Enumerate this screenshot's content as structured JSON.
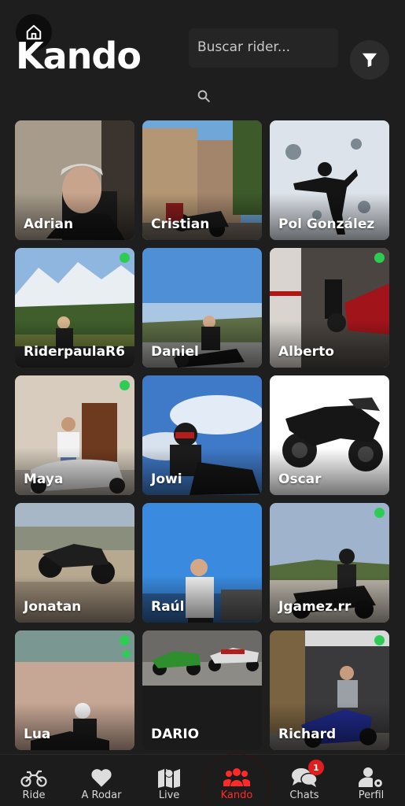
{
  "header": {
    "logo": "Kando",
    "search_placeholder": "Buscar rider..."
  },
  "riders": [
    {
      "name": "Adrian",
      "online": false
    },
    {
      "name": "Cristian",
      "online": false
    },
    {
      "name": "Pol González",
      "online": false
    },
    {
      "name": "RiderpaulaR6",
      "online": true
    },
    {
      "name": "Daniel",
      "online": false
    },
    {
      "name": "Alberto",
      "online": true
    },
    {
      "name": "Maya",
      "online": true
    },
    {
      "name": "Jowi",
      "online": false
    },
    {
      "name": "Oscar",
      "online": false
    },
    {
      "name": "Jonatan",
      "online": false
    },
    {
      "name": "Raúl",
      "online": false
    },
    {
      "name": "Jgamez.rr",
      "online": true
    },
    {
      "name": "Lua",
      "online": true
    },
    {
      "name": "DARIO",
      "online": false
    },
    {
      "name": "Richard",
      "online": true
    }
  ],
  "nav": {
    "items": [
      {
        "label": "Ride",
        "icon": "motorcycle-icon"
      },
      {
        "label": "A Rodar",
        "icon": "heart-icon"
      },
      {
        "label": "Live",
        "icon": "map-pin-icon"
      },
      {
        "label": "Kando",
        "icon": "users-icon"
      },
      {
        "label": "Chats",
        "icon": "chat-icon",
        "badge": "1"
      },
      {
        "label": "Perfil",
        "icon": "user-gear-icon"
      }
    ],
    "active_index": 3
  },
  "colors": {
    "accent": "#ff2a2a",
    "online": "#2ecc55",
    "background": "#1e1e1e"
  }
}
